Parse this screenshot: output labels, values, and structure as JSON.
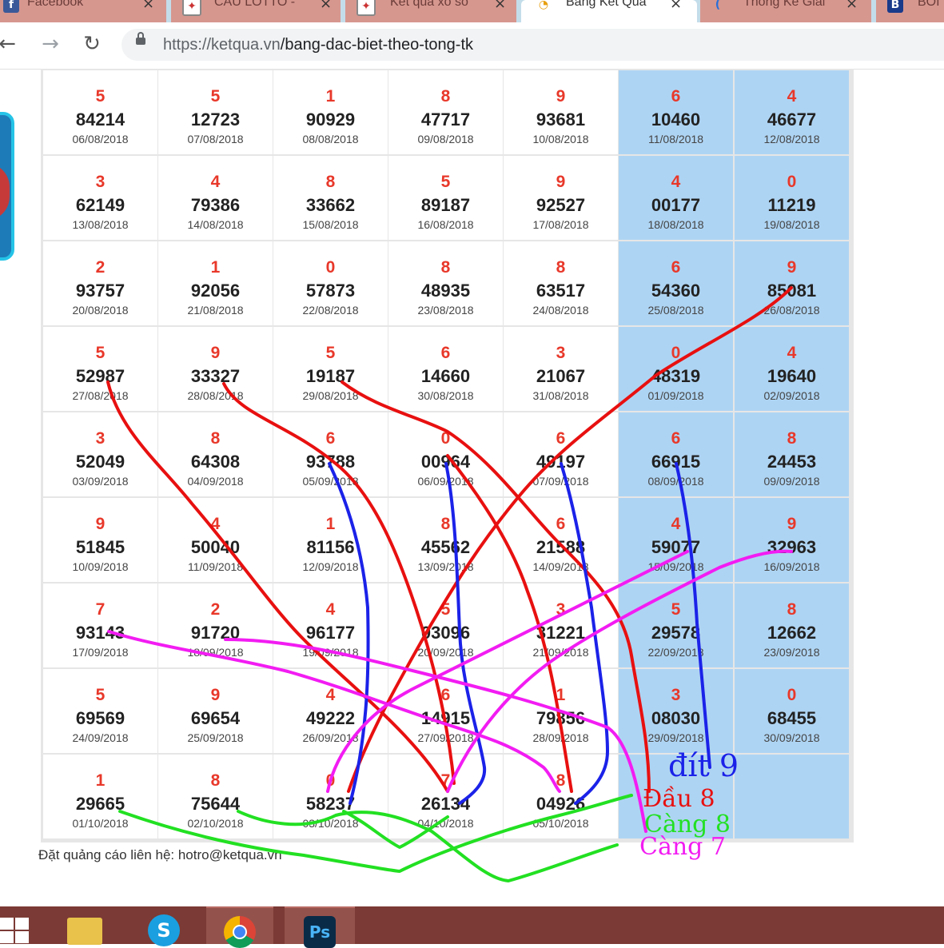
{
  "browser": {
    "tabs": [
      {
        "title": "Facebook",
        "icon": "facebook-icon",
        "active": false
      },
      {
        "title": "CẦU LÔTTO -",
        "icon": "lotto-icon",
        "active": false
      },
      {
        "title": "Kết quả xổ số",
        "icon": "lotto-icon",
        "active": false
      },
      {
        "title": "Bảng Kết Quả",
        "icon": "ketqua-icon",
        "active": true
      },
      {
        "title": "Thống Kê Giải",
        "icon": "stats-icon",
        "active": false
      },
      {
        "title": "BÓI",
        "icon": "b-icon",
        "active": false
      }
    ],
    "tab_close_glyph": "×",
    "url_host": "https://ketqua.vn",
    "url_path": "/bang-dac-biet-theo-tong-tk",
    "nav": {
      "back": "←",
      "forward": "→",
      "reload": "↻"
    }
  },
  "results": {
    "rows": [
      [
        {
          "t": "5",
          "n": "84214",
          "d": "06/08/2018"
        },
        {
          "t": "5",
          "n": "12723",
          "d": "07/08/2018"
        },
        {
          "t": "1",
          "n": "90929",
          "d": "08/08/2018"
        },
        {
          "t": "8",
          "n": "47717",
          "d": "09/08/2018"
        },
        {
          "t": "9",
          "n": "93681",
          "d": "10/08/2018"
        },
        {
          "t": "6",
          "n": "10460",
          "d": "11/08/2018"
        },
        {
          "t": "4",
          "n": "46677",
          "d": "12/08/2018"
        }
      ],
      [
        {
          "t": "3",
          "n": "62149",
          "d": "13/08/2018"
        },
        {
          "t": "4",
          "n": "79386",
          "d": "14/08/2018"
        },
        {
          "t": "8",
          "n": "33662",
          "d": "15/08/2018"
        },
        {
          "t": "5",
          "n": "89187",
          "d": "16/08/2018"
        },
        {
          "t": "9",
          "n": "92527",
          "d": "17/08/2018"
        },
        {
          "t": "4",
          "n": "00177",
          "d": "18/08/2018"
        },
        {
          "t": "0",
          "n": "11219",
          "d": "19/08/2018"
        }
      ],
      [
        {
          "t": "2",
          "n": "93757",
          "d": "20/08/2018"
        },
        {
          "t": "1",
          "n": "92056",
          "d": "21/08/2018"
        },
        {
          "t": "0",
          "n": "57873",
          "d": "22/08/2018"
        },
        {
          "t": "8",
          "n": "48935",
          "d": "23/08/2018"
        },
        {
          "t": "8",
          "n": "63517",
          "d": "24/08/2018"
        },
        {
          "t": "6",
          "n": "54360",
          "d": "25/08/2018"
        },
        {
          "t": "9",
          "n": "85081",
          "d": "26/08/2018"
        }
      ],
      [
        {
          "t": "5",
          "n": "52987",
          "d": "27/08/2018"
        },
        {
          "t": "9",
          "n": "33327",
          "d": "28/08/2018"
        },
        {
          "t": "5",
          "n": "19187",
          "d": "29/08/2018"
        },
        {
          "t": "6",
          "n": "14660",
          "d": "30/08/2018"
        },
        {
          "t": "3",
          "n": "21067",
          "d": "31/08/2018"
        },
        {
          "t": "0",
          "n": "48319",
          "d": "01/09/2018"
        },
        {
          "t": "4",
          "n": "19640",
          "d": "02/09/2018"
        }
      ],
      [
        {
          "t": "3",
          "n": "52049",
          "d": "03/09/2018"
        },
        {
          "t": "8",
          "n": "64308",
          "d": "04/09/2018"
        },
        {
          "t": "6",
          "n": "93788",
          "d": "05/09/2018"
        },
        {
          "t": "0",
          "n": "00964",
          "d": "06/09/2018"
        },
        {
          "t": "6",
          "n": "49197",
          "d": "07/09/2018"
        },
        {
          "t": "6",
          "n": "66915",
          "d": "08/09/2018"
        },
        {
          "t": "8",
          "n": "24453",
          "d": "09/09/2018"
        }
      ],
      [
        {
          "t": "9",
          "n": "51845",
          "d": "10/09/2018"
        },
        {
          "t": "4",
          "n": "50040",
          "d": "11/09/2018"
        },
        {
          "t": "1",
          "n": "81156",
          "d": "12/09/2018"
        },
        {
          "t": "8",
          "n": "45562",
          "d": "13/09/2018"
        },
        {
          "t": "6",
          "n": "21588",
          "d": "14/09/2018"
        },
        {
          "t": "4",
          "n": "59077",
          "d": "15/09/2018"
        },
        {
          "t": "9",
          "n": "32963",
          "d": "16/09/2018"
        }
      ],
      [
        {
          "t": "7",
          "n": "93143",
          "d": "17/09/2018"
        },
        {
          "t": "2",
          "n": "91720",
          "d": "18/09/2018"
        },
        {
          "t": "4",
          "n": "96177",
          "d": "19/09/2018"
        },
        {
          "t": "5",
          "n": "03096",
          "d": "20/09/2018"
        },
        {
          "t": "3",
          "n": "31221",
          "d": "21/09/2018"
        },
        {
          "t": "5",
          "n": "29578",
          "d": "22/09/2018"
        },
        {
          "t": "8",
          "n": "12662",
          "d": "23/09/2018"
        }
      ],
      [
        {
          "t": "5",
          "n": "69569",
          "d": "24/09/2018"
        },
        {
          "t": "9",
          "n": "69654",
          "d": "25/09/2018"
        },
        {
          "t": "4",
          "n": "49222",
          "d": "26/09/2018"
        },
        {
          "t": "6",
          "n": "14915",
          "d": "27/09/2018"
        },
        {
          "t": "1",
          "n": "79856",
          "d": "28/09/2018"
        },
        {
          "t": "3",
          "n": "08030",
          "d": "29/09/2018"
        },
        {
          "t": "0",
          "n": "68455",
          "d": "30/09/2018"
        }
      ],
      [
        {
          "t": "1",
          "n": "29665",
          "d": "01/10/2018"
        },
        {
          "t": "8",
          "n": "75644",
          "d": "02/10/2018"
        },
        {
          "t": "0",
          "n": "58237",
          "d": "03/10/2018"
        },
        {
          "t": "7",
          "n": "26134",
          "d": "04/10/2018"
        },
        {
          "t": "8",
          "n": "04926",
          "d": "05/10/2018"
        },
        {
          "t": "",
          "n": "",
          "d": ""
        },
        {
          "t": "",
          "n": "",
          "d": ""
        }
      ]
    ]
  },
  "footer": {
    "ad_text": "Đặt quảng cáo liên hệ: hotro@ketqua.vn"
  },
  "annotations": {
    "dit": "đít 9",
    "dau": "Đầu 8",
    "cang8": "Càng 8",
    "cang7": "Càng 7"
  },
  "colors": {
    "red": "#e81010",
    "blue": "#1b22e8",
    "green": "#22e022",
    "magenta": "#f21cf2",
    "weekend": "#aed4f3",
    "digit": "#e8382a"
  },
  "taskbar": {
    "items": [
      {
        "name": "start-button",
        "icon": "windows-icon"
      },
      {
        "name": "file-explorer",
        "icon": "folder-icon"
      },
      {
        "name": "skype",
        "icon": "skype-icon",
        "label": "S"
      },
      {
        "name": "chrome",
        "icon": "chrome-icon"
      },
      {
        "name": "photoshop",
        "icon": "photoshop-icon",
        "label": "Ps"
      }
    ]
  }
}
